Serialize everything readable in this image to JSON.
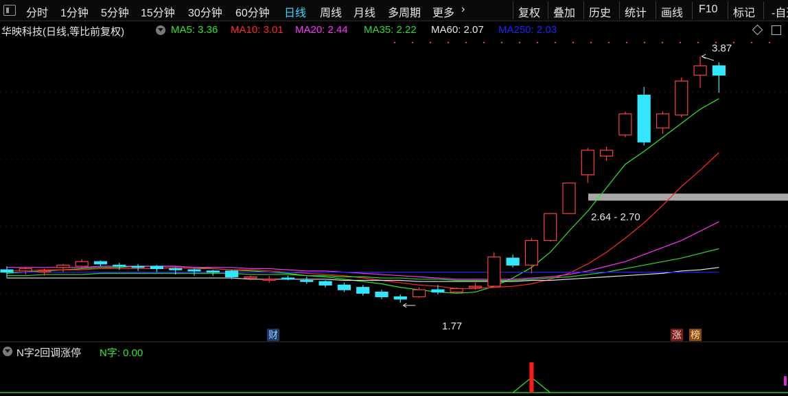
{
  "toolbar": {
    "periods": [
      "分时",
      "1分钟",
      "5分钟",
      "15分钟",
      "30分钟",
      "60分钟",
      "日线",
      "周线",
      "月线",
      "多周期",
      "更多"
    ],
    "active_period": "日线",
    "more_arrow": "›",
    "right_buttons": [
      "复权",
      "叠加",
      "历史",
      "统计",
      "画线",
      "F10",
      "标记",
      "自选"
    ],
    "right_prefix": "-"
  },
  "chart_title": "华映科技(日线,等比前复权)",
  "ma_legend": [
    {
      "label": "MA5: 3.36",
      "color": "#2ee82e"
    },
    {
      "label": "MA10: 3.01",
      "color": "#ff2a2a"
    },
    {
      "label": "MA20: 2.44",
      "color": "#ff33ff"
    },
    {
      "label": "MA35: 2.22",
      "color": "#33d833"
    },
    {
      "label": "MA60: 2.07",
      "color": "#e6e6e6"
    },
    {
      "label": "MA250: 2.03",
      "color": "#2222ff"
    }
  ],
  "annotations": {
    "high_label": "3.87",
    "low_label": "1.77",
    "zone_label": "2.64 - 2.70",
    "badge_cai": "财",
    "badge_zhang": "涨",
    "badge_bang": "榜"
  },
  "indicator": {
    "title": "N字2回调涨停",
    "value_label": "N字: 0.00"
  },
  "colors": {
    "up": "#ff4040",
    "down": "#33e6ff",
    "background": "#000000",
    "grid": "#7a0000",
    "zone": "#a8a8a8",
    "dots": "#cc33cc"
  },
  "chart_data": {
    "type": "candlestick",
    "ylim": [
      1.6,
      4.0
    ],
    "candles": [
      {
        "o": 2.05,
        "h": 2.08,
        "l": 1.98,
        "c": 2.03
      },
      {
        "o": 2.04,
        "h": 2.07,
        "l": 2.01,
        "c": 2.06
      },
      {
        "o": 2.04,
        "h": 2.06,
        "l": 2.0,
        "c": 2.04
      },
      {
        "o": 2.07,
        "h": 2.1,
        "l": 2.03,
        "c": 2.09
      },
      {
        "o": 2.08,
        "h": 2.14,
        "l": 2.06,
        "c": 2.12
      },
      {
        "o": 2.12,
        "h": 2.13,
        "l": 2.08,
        "c": 2.1
      },
      {
        "o": 2.09,
        "h": 2.11,
        "l": 2.05,
        "c": 2.08
      },
      {
        "o": 2.08,
        "h": 2.1,
        "l": 2.04,
        "c": 2.07
      },
      {
        "o": 2.08,
        "h": 2.09,
        "l": 2.03,
        "c": 2.06
      },
      {
        "o": 2.06,
        "h": 2.07,
        "l": 2.01,
        "c": 2.05
      },
      {
        "o": 2.05,
        "h": 2.06,
        "l": 2.0,
        "c": 2.04
      },
      {
        "o": 2.04,
        "h": 2.05,
        "l": 2.0,
        "c": 2.03
      },
      {
        "o": 2.04,
        "h": 2.05,
        "l": 1.97,
        "c": 1.99
      },
      {
        "o": 1.98,
        "h": 2.0,
        "l": 1.96,
        "c": 1.99
      },
      {
        "o": 1.97,
        "h": 2.0,
        "l": 1.94,
        "c": 1.97
      },
      {
        "o": 1.98,
        "h": 2.0,
        "l": 1.96,
        "c": 1.97
      },
      {
        "o": 1.96,
        "h": 1.99,
        "l": 1.93,
        "c": 1.95
      },
      {
        "o": 1.95,
        "h": 1.96,
        "l": 1.9,
        "c": 1.92
      },
      {
        "o": 1.92,
        "h": 1.94,
        "l": 1.86,
        "c": 1.88
      },
      {
        "o": 1.9,
        "h": 1.92,
        "l": 1.83,
        "c": 1.85
      },
      {
        "o": 1.86,
        "h": 1.88,
        "l": 1.8,
        "c": 1.82
      },
      {
        "o": 1.82,
        "h": 1.84,
        "l": 1.77,
        "c": 1.8
      },
      {
        "o": 1.82,
        "h": 1.9,
        "l": 1.81,
        "c": 1.88
      },
      {
        "o": 1.88,
        "h": 1.92,
        "l": 1.84,
        "c": 1.86
      },
      {
        "o": 1.86,
        "h": 1.9,
        "l": 1.85,
        "c": 1.89
      },
      {
        "o": 1.9,
        "h": 1.94,
        "l": 1.88,
        "c": 1.91
      },
      {
        "o": 1.91,
        "h": 2.2,
        "l": 1.9,
        "c": 2.16
      },
      {
        "o": 2.15,
        "h": 2.18,
        "l": 2.07,
        "c": 2.09
      },
      {
        "o": 2.09,
        "h": 2.32,
        "l": 2.02,
        "c": 2.3
      },
      {
        "o": 2.3,
        "h": 2.53,
        "l": 2.29,
        "c": 2.53
      },
      {
        "o": 2.53,
        "h": 2.79,
        "l": 2.53,
        "c": 2.79
      },
      {
        "o": 2.86,
        "h": 3.09,
        "l": 2.79,
        "c": 3.07
      },
      {
        "o": 3.02,
        "h": 3.1,
        "l": 2.98,
        "c": 3.07
      },
      {
        "o": 3.2,
        "h": 3.4,
        "l": 3.18,
        "c": 3.38
      },
      {
        "o": 3.54,
        "h": 3.61,
        "l": 3.11,
        "c": 3.14
      },
      {
        "o": 3.26,
        "h": 3.4,
        "l": 3.21,
        "c": 3.38
      },
      {
        "o": 3.37,
        "h": 3.69,
        "l": 3.35,
        "c": 3.66
      },
      {
        "o": 3.71,
        "h": 3.87,
        "l": 3.6,
        "c": 3.79
      },
      {
        "o": 3.79,
        "h": 3.82,
        "l": 3.56,
        "c": 3.71
      }
    ],
    "ma_series": [
      {
        "name": "MA5",
        "color": "#2ee82e",
        "values": [
          2.02,
          2.03,
          2.04,
          2.05,
          2.06,
          2.07,
          2.07,
          2.08,
          2.08,
          2.08,
          2.07,
          2.06,
          2.05,
          2.04,
          2.03,
          2.02,
          2.0,
          1.99,
          1.97,
          1.95,
          1.93,
          1.9,
          1.88,
          1.86,
          1.85,
          1.86,
          1.91,
          1.98,
          2.07,
          2.2,
          2.38,
          2.55,
          2.75,
          2.95,
          3.06,
          3.18,
          3.3,
          3.42,
          3.51
        ]
      },
      {
        "name": "MA10",
        "color": "#ff2a2a",
        "values": [
          2.04,
          2.04,
          2.05,
          2.05,
          2.05,
          2.06,
          2.06,
          2.06,
          2.06,
          2.07,
          2.06,
          2.06,
          2.05,
          2.05,
          2.04,
          2.03,
          2.02,
          2.01,
          2.0,
          1.98,
          1.96,
          1.94,
          1.92,
          1.91,
          1.89,
          1.89,
          1.9,
          1.91,
          1.93,
          1.97,
          2.02,
          2.1,
          2.2,
          2.32,
          2.45,
          2.6,
          2.76,
          2.9,
          3.05
        ]
      },
      {
        "name": "MA20",
        "color": "#ff33ff",
        "values": [
          2.07,
          2.07,
          2.07,
          2.07,
          2.07,
          2.08,
          2.08,
          2.08,
          2.08,
          2.08,
          2.07,
          2.07,
          2.07,
          2.06,
          2.06,
          2.05,
          2.04,
          2.04,
          2.03,
          2.02,
          2.01,
          2.0,
          1.99,
          1.98,
          1.97,
          1.97,
          1.97,
          1.97,
          1.98,
          1.99,
          2.01,
          2.04,
          2.08,
          2.12,
          2.18,
          2.24,
          2.3,
          2.38,
          2.46
        ]
      },
      {
        "name": "MA35",
        "color": "#33d833",
        "values": [
          2.0,
          2.0,
          2.01,
          2.01,
          2.01,
          2.02,
          2.02,
          2.02,
          2.02,
          2.02,
          2.02,
          2.02,
          2.02,
          2.01,
          2.01,
          2.01,
          2.0,
          2.0,
          1.99,
          1.99,
          1.98,
          1.98,
          1.97,
          1.97,
          1.96,
          1.96,
          1.96,
          1.96,
          1.97,
          1.98,
          1.99,
          2.01,
          2.03,
          2.06,
          2.09,
          2.12,
          2.15,
          2.19,
          2.23
        ]
      },
      {
        "name": "MA60",
        "color": "#e6e6e6",
        "values": [
          1.98,
          1.98,
          1.98,
          1.98,
          1.98,
          1.98,
          1.98,
          1.98,
          1.98,
          1.98,
          1.98,
          1.98,
          1.98,
          1.97,
          1.97,
          1.97,
          1.97,
          1.97,
          1.96,
          1.96,
          1.96,
          1.96,
          1.95,
          1.95,
          1.95,
          1.95,
          1.95,
          1.95,
          1.96,
          1.96,
          1.97,
          1.98,
          1.99,
          2.0,
          2.01,
          2.02,
          2.04,
          2.05,
          2.07
        ]
      },
      {
        "name": "MA250",
        "color": "#2222ff",
        "values": [
          2.03,
          2.03,
          2.03,
          2.03,
          2.03,
          2.03,
          2.03,
          2.03,
          2.03,
          2.03,
          2.03,
          2.03,
          2.03,
          2.03,
          2.03,
          2.03,
          2.03,
          2.03,
          2.03,
          2.03,
          2.03,
          2.03,
          2.03,
          2.03,
          2.03,
          2.03,
          2.03,
          2.03,
          2.03,
          2.03,
          2.03,
          2.03,
          2.03,
          2.03,
          2.03,
          2.03,
          2.03,
          2.03,
          2.03
        ]
      }
    ],
    "zone": [
      2.64,
      2.7
    ],
    "indicator_values": [
      0,
      0,
      0,
      0,
      0,
      0,
      0,
      0,
      0,
      0,
      0,
      0,
      0,
      0,
      0,
      0,
      0,
      0,
      0,
      0,
      0,
      0,
      0,
      0,
      0,
      0,
      0,
      0,
      1,
      0,
      0,
      0,
      0,
      0,
      0,
      0,
      0,
      0,
      0
    ]
  }
}
